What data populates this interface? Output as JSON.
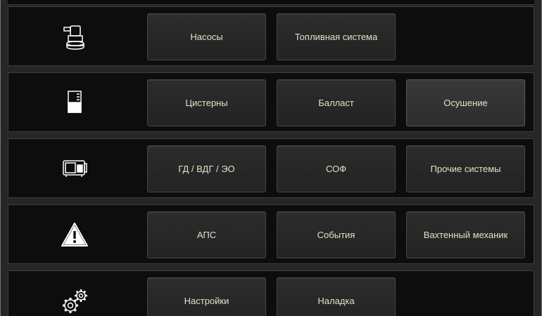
{
  "rows": [
    {
      "icon": "pump-icon",
      "buttons": [
        "Насосы",
        "Топливная система"
      ]
    },
    {
      "icon": "tank-icon",
      "buttons": [
        "Цистерны",
        "Балласт",
        "Осушение"
      ]
    },
    {
      "icon": "engine-icon",
      "buttons": [
        "ГД / ВДГ / ЭО",
        "СОФ",
        "Прочие системы"
      ]
    },
    {
      "icon": "warning-icon",
      "buttons": [
        "АПС",
        "События",
        "Вахтенный механик"
      ]
    },
    {
      "icon": "gears-icon",
      "buttons": [
        "Настройки",
        "Наладка"
      ]
    }
  ],
  "active_button": "Осушение",
  "colors": {
    "background": "#262626",
    "row_background": "#0d0d0d",
    "button_background": "#2a2a2a",
    "button_text": "#e2e2c8",
    "icon": "#ffffff"
  }
}
